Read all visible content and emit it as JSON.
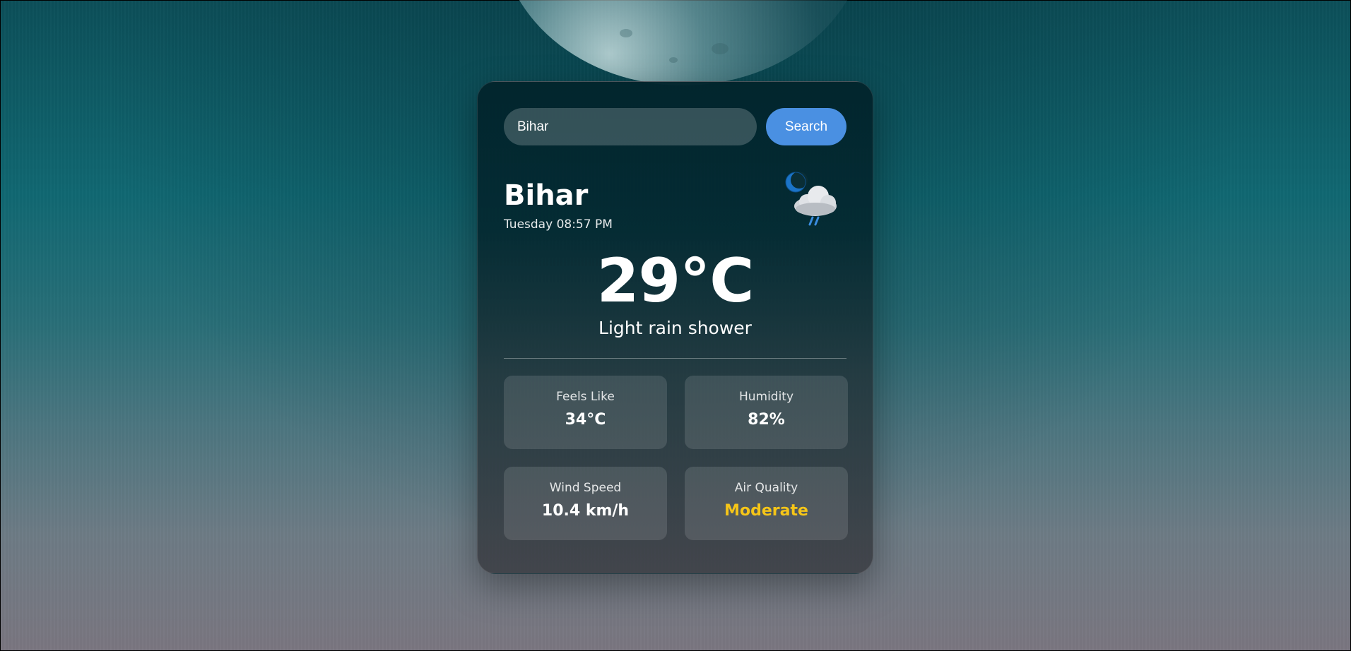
{
  "search": {
    "value": "Bihar",
    "button_label": "Search"
  },
  "location": {
    "city": "Bihar",
    "datetime": "Tuesday 08:57 PM",
    "icon": "moon-cloud-rain-icon"
  },
  "current": {
    "temperature": "29°C",
    "condition": "Light rain shower"
  },
  "details": [
    {
      "label": "Feels Like",
      "value": "34°C"
    },
    {
      "label": "Humidity",
      "value": "82%"
    },
    {
      "label": "Wind Speed",
      "value": "10.4 km/h"
    },
    {
      "label": "Air Quality",
      "value": "Moderate",
      "color": "#f5c518"
    }
  ],
  "colors": {
    "accent": "#4a90e2",
    "air_quality_moderate": "#f5c518"
  }
}
